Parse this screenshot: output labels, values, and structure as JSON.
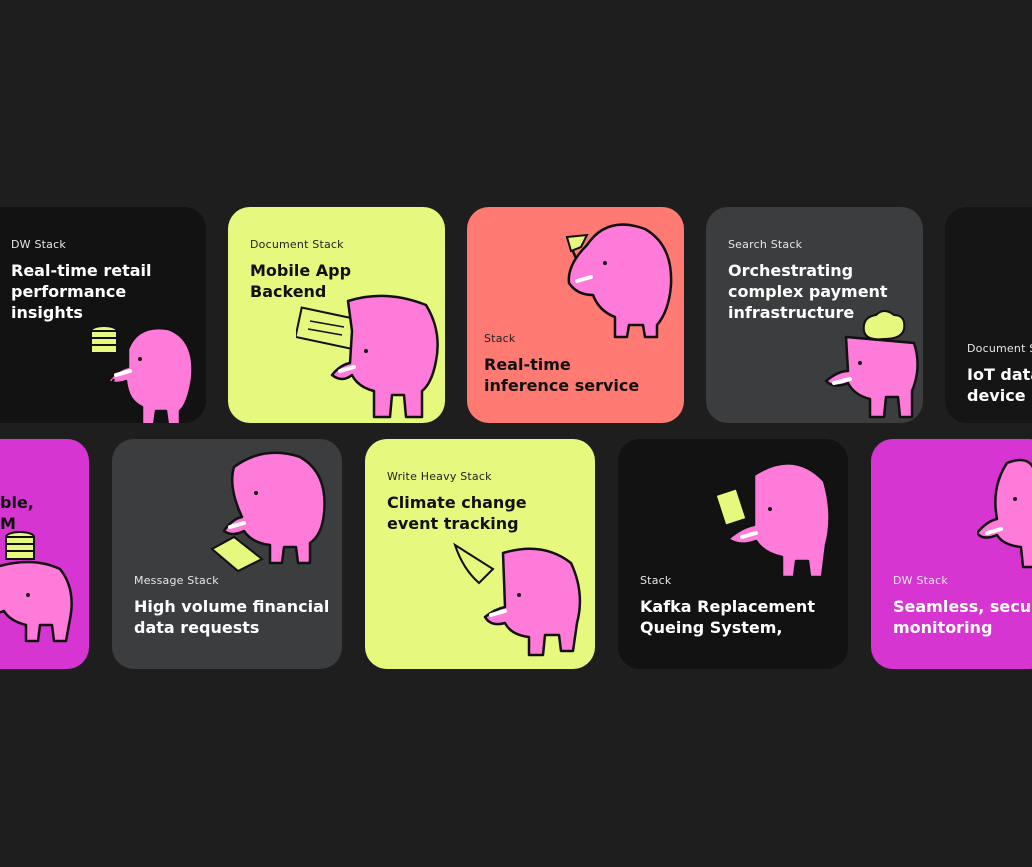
{
  "colors": {
    "background": "#1e1e1f",
    "card_black": "#121212",
    "card_lime": "#e7f87e",
    "card_coral": "#fe7a72",
    "card_gray": "#3b3d3e",
    "card_magenta": "#d635d1",
    "elephant": "#ff7bd9",
    "accent_yellow": "#e7f87e"
  },
  "row1": [
    {
      "tag": "DW Stack",
      "title_lines": [
        "Real-time retail",
        "performance",
        "insights"
      ],
      "illustration": "elephant-with-coins-icon"
    },
    {
      "tag": "Document Stack",
      "title_lines": [
        "Mobile App",
        "Backend"
      ],
      "illustration": "elephant-with-document-icon"
    },
    {
      "tag": "Stack",
      "title_lines": [
        "Real-time",
        "inference service"
      ],
      "illustration": "elephant-with-flag-icon"
    },
    {
      "tag": "Search Stack",
      "title_lines": [
        "Orchestrating",
        "complex payment",
        "infrastructure"
      ],
      "illustration": "elephant-with-cloud-icon"
    },
    {
      "tag": "Document S",
      "title_lines": [
        "IoT data",
        "device s"
      ],
      "illustration": ""
    }
  ],
  "row2": [
    {
      "tag": "",
      "title_lines": [
        "ble,",
        "M"
      ],
      "illustration": "elephant-with-coins-icon"
    },
    {
      "tag": "Message Stack",
      "title_lines": [
        "High volume financial",
        "data requests"
      ],
      "illustration": "elephant-with-laptop-icon"
    },
    {
      "tag": "Write Heavy Stack",
      "title_lines": [
        "Climate change",
        "event tracking"
      ],
      "illustration": "elephant-with-laptop-icon"
    },
    {
      "tag": "Stack",
      "title_lines": [
        "Kafka Replacement",
        "Queing System,"
      ],
      "illustration": "elephant-with-document-icon"
    },
    {
      "tag": "DW Stack",
      "title_lines": [
        "Seamless, secure",
        "monitoring"
      ],
      "illustration": "elephant-icon"
    }
  ]
}
